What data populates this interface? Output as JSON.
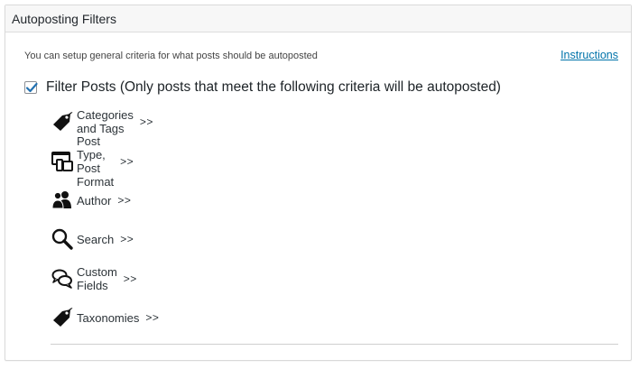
{
  "panel": {
    "title": "Autoposting Filters",
    "intro": "You can setup general criteria for what posts should be autoposted",
    "instructions_link": "Instructions"
  },
  "filter": {
    "checked": true,
    "label": "Filter Posts (Only posts that meet the following criteria will be autoposted)"
  },
  "items": [
    {
      "label": "Categories and Tags",
      "arrows": ">>",
      "icon": "tag-icon"
    },
    {
      "label": "Post Type, Post Format",
      "arrows": ">>",
      "icon": "post-type-icon"
    },
    {
      "label": "Author",
      "arrows": ">>",
      "icon": "users-icon"
    },
    {
      "label": "Search",
      "arrows": ">>",
      "icon": "search-icon"
    },
    {
      "label": "Custom Fields",
      "arrows": ">>",
      "icon": "chat-bubbles-icon"
    },
    {
      "label": "Taxonomies",
      "arrows": ">>",
      "icon": "tag-icon"
    }
  ],
  "colors": {
    "link": "#0073aa",
    "checkmark": "#2271b1",
    "text": "#23282d"
  }
}
